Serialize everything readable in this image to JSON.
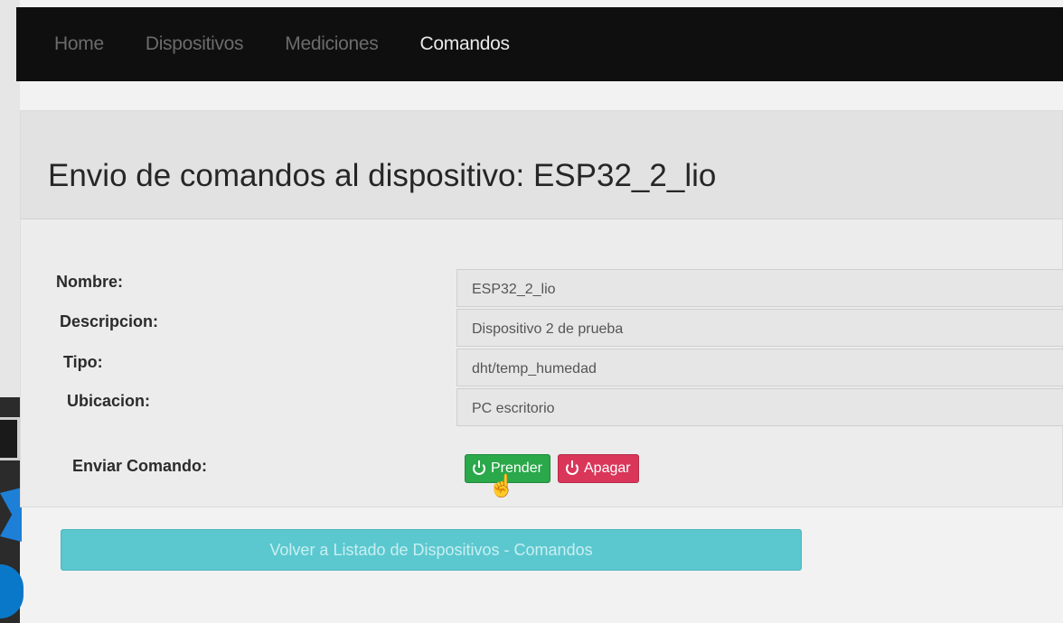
{
  "navbar": {
    "links": [
      "Home",
      "Dispositivos",
      "Mediciones",
      "Comandos"
    ],
    "active": "Comandos"
  },
  "page": {
    "title": "Envio de comandos al dispositivo: ESP32_2_lio"
  },
  "form": {
    "nombre_label": "Nombre:",
    "nombre_value": "ESP32_2_lio",
    "descripcion_label": "Descripcion:",
    "descripcion_value": "Dispositivo 2 de prueba",
    "tipo_label": "Tipo:",
    "tipo_value": "dht/temp_humedad",
    "ubicacion_label": "Ubicacion:",
    "ubicacion_value": "PC escritorio",
    "comando_label": "Enviar Comando:"
  },
  "buttons": {
    "on_label": "Prender",
    "off_label": "Apagar",
    "back_label": "Volver a Listado de Dispositivos - Comandos"
  },
  "icons": {
    "power": "power-icon",
    "pointer": "hand-pointer-icon"
  },
  "colors": {
    "navbar_bg": "#0f0f0f",
    "on_button": "#2aa84a",
    "off_button": "#d9365a",
    "back_button": "#5bc8cf"
  }
}
